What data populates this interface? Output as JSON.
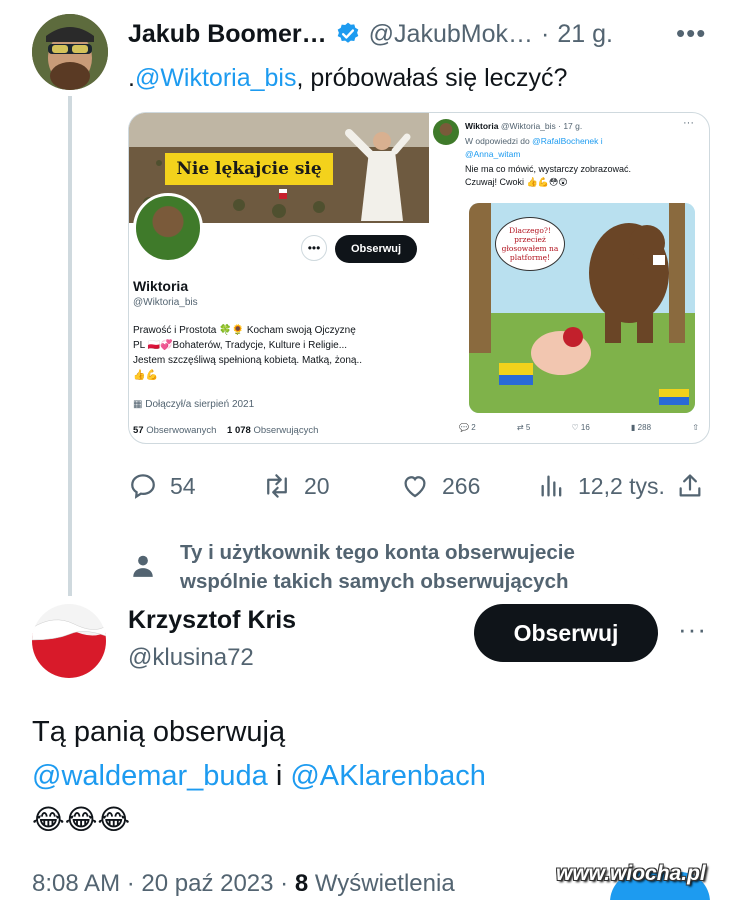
{
  "tweet1": {
    "name": "Jakub Boomer…",
    "handle": "@JakubMok…",
    "separator": "·",
    "time": "21 g.",
    "text_prefix": ".",
    "mention": "@Wiktoria_bis",
    "text": ", próbowałaś się leczyć?",
    "verified_color": "#1d9bf0"
  },
  "embed_profile": {
    "banner_sign": "Nie lękajcie się",
    "follow_label": "Obserwuj",
    "more_label": "•••",
    "name": "Wiktoria",
    "handle": "@Wiktoria_bis",
    "bio": [
      "Prawość i Prostota 🍀🌻 Kocham swoją Ojczyznę",
      "PL 🇵🇱💞Bohaterów, Tradycje, Kulture i Religie...",
      "Jestem szczęśliwą spełnioną kobietą. Matką, żoną..",
      "👍💪"
    ],
    "joined": "Dołączył/a sierpień 2021",
    "following_count": "57",
    "following_label": "Obserwowanych",
    "followers_count": "1 078",
    "followers_label": "Obserwujących"
  },
  "embed_reply": {
    "name": "Wiktoria",
    "handle": "@Wiktoria_bis · 17 g.",
    "more": "···",
    "reply_prefix": "W odpowiedzi do",
    "reply_to_1": "@RafalBochenek i",
    "reply_to_2": "@Anna_witam",
    "text_1": "Nie ma co mówić, wystarczy zobrazować.",
    "text_2": "Czuwaj!  Cwoki 👍💪😳😲",
    "bubble_text": "Dlaczego?! przecież głosowałem na platformę!",
    "replies": "2",
    "retweets": "5",
    "likes": "16",
    "views": "288"
  },
  "actions": {
    "replies": "54",
    "retweets": "20",
    "likes": "266",
    "views": "12,2 tys."
  },
  "notice": {
    "line1": "Ty i użytkownik tego konta obserwujecie",
    "line2": "wspólnie takich samych obserwujących"
  },
  "tweet2": {
    "name": "Krzysztof Kris",
    "handle": "@klusina72",
    "follow_label": "Obserwuj",
    "more_label": "···",
    "line1": "Tą panią obserwują",
    "mention1": "@waldemar_buda",
    "conj": " i ",
    "mention2": "@AKlarenbach",
    "emojis": "😂😂😂",
    "time": "8:08 AM · 20 paź 2023 · ",
    "views_count": "8",
    "views_label": " Wyświetlenia"
  },
  "watermark": "www.wiocha.pl"
}
